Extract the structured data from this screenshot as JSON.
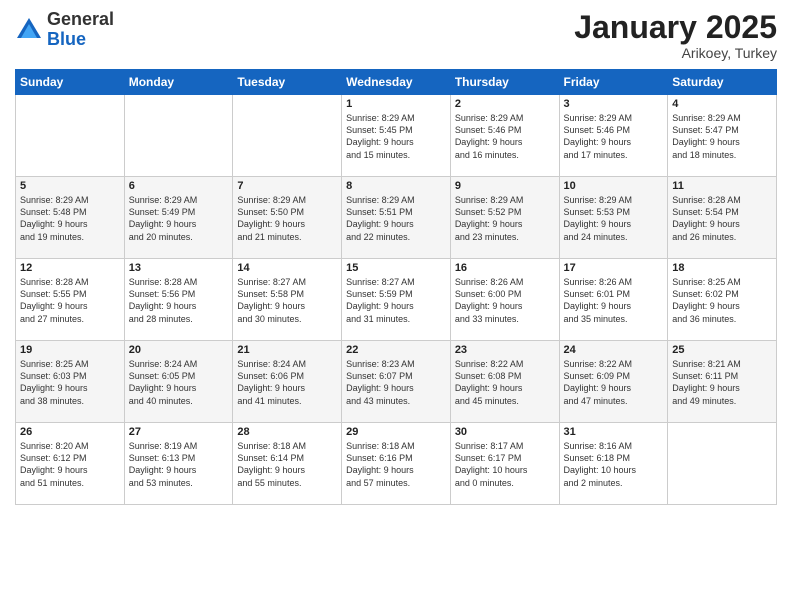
{
  "header": {
    "logo_line1": "General",
    "logo_line2": "Blue",
    "month": "January 2025",
    "location": "Arikoey, Turkey"
  },
  "weekdays": [
    "Sunday",
    "Monday",
    "Tuesday",
    "Wednesday",
    "Thursday",
    "Friday",
    "Saturday"
  ],
  "weeks": [
    [
      {
        "day": "",
        "info": ""
      },
      {
        "day": "",
        "info": ""
      },
      {
        "day": "",
        "info": ""
      },
      {
        "day": "1",
        "info": "Sunrise: 8:29 AM\nSunset: 5:45 PM\nDaylight: 9 hours\nand 15 minutes."
      },
      {
        "day": "2",
        "info": "Sunrise: 8:29 AM\nSunset: 5:46 PM\nDaylight: 9 hours\nand 16 minutes."
      },
      {
        "day": "3",
        "info": "Sunrise: 8:29 AM\nSunset: 5:46 PM\nDaylight: 9 hours\nand 17 minutes."
      },
      {
        "day": "4",
        "info": "Sunrise: 8:29 AM\nSunset: 5:47 PM\nDaylight: 9 hours\nand 18 minutes."
      }
    ],
    [
      {
        "day": "5",
        "info": "Sunrise: 8:29 AM\nSunset: 5:48 PM\nDaylight: 9 hours\nand 19 minutes."
      },
      {
        "day": "6",
        "info": "Sunrise: 8:29 AM\nSunset: 5:49 PM\nDaylight: 9 hours\nand 20 minutes."
      },
      {
        "day": "7",
        "info": "Sunrise: 8:29 AM\nSunset: 5:50 PM\nDaylight: 9 hours\nand 21 minutes."
      },
      {
        "day": "8",
        "info": "Sunrise: 8:29 AM\nSunset: 5:51 PM\nDaylight: 9 hours\nand 22 minutes."
      },
      {
        "day": "9",
        "info": "Sunrise: 8:29 AM\nSunset: 5:52 PM\nDaylight: 9 hours\nand 23 minutes."
      },
      {
        "day": "10",
        "info": "Sunrise: 8:29 AM\nSunset: 5:53 PM\nDaylight: 9 hours\nand 24 minutes."
      },
      {
        "day": "11",
        "info": "Sunrise: 8:28 AM\nSunset: 5:54 PM\nDaylight: 9 hours\nand 26 minutes."
      }
    ],
    [
      {
        "day": "12",
        "info": "Sunrise: 8:28 AM\nSunset: 5:55 PM\nDaylight: 9 hours\nand 27 minutes."
      },
      {
        "day": "13",
        "info": "Sunrise: 8:28 AM\nSunset: 5:56 PM\nDaylight: 9 hours\nand 28 minutes."
      },
      {
        "day": "14",
        "info": "Sunrise: 8:27 AM\nSunset: 5:58 PM\nDaylight: 9 hours\nand 30 minutes."
      },
      {
        "day": "15",
        "info": "Sunrise: 8:27 AM\nSunset: 5:59 PM\nDaylight: 9 hours\nand 31 minutes."
      },
      {
        "day": "16",
        "info": "Sunrise: 8:26 AM\nSunset: 6:00 PM\nDaylight: 9 hours\nand 33 minutes."
      },
      {
        "day": "17",
        "info": "Sunrise: 8:26 AM\nSunset: 6:01 PM\nDaylight: 9 hours\nand 35 minutes."
      },
      {
        "day": "18",
        "info": "Sunrise: 8:25 AM\nSunset: 6:02 PM\nDaylight: 9 hours\nand 36 minutes."
      }
    ],
    [
      {
        "day": "19",
        "info": "Sunrise: 8:25 AM\nSunset: 6:03 PM\nDaylight: 9 hours\nand 38 minutes."
      },
      {
        "day": "20",
        "info": "Sunrise: 8:24 AM\nSunset: 6:05 PM\nDaylight: 9 hours\nand 40 minutes."
      },
      {
        "day": "21",
        "info": "Sunrise: 8:24 AM\nSunset: 6:06 PM\nDaylight: 9 hours\nand 41 minutes."
      },
      {
        "day": "22",
        "info": "Sunrise: 8:23 AM\nSunset: 6:07 PM\nDaylight: 9 hours\nand 43 minutes."
      },
      {
        "day": "23",
        "info": "Sunrise: 8:22 AM\nSunset: 6:08 PM\nDaylight: 9 hours\nand 45 minutes."
      },
      {
        "day": "24",
        "info": "Sunrise: 8:22 AM\nSunset: 6:09 PM\nDaylight: 9 hours\nand 47 minutes."
      },
      {
        "day": "25",
        "info": "Sunrise: 8:21 AM\nSunset: 6:11 PM\nDaylight: 9 hours\nand 49 minutes."
      }
    ],
    [
      {
        "day": "26",
        "info": "Sunrise: 8:20 AM\nSunset: 6:12 PM\nDaylight: 9 hours\nand 51 minutes."
      },
      {
        "day": "27",
        "info": "Sunrise: 8:19 AM\nSunset: 6:13 PM\nDaylight: 9 hours\nand 53 minutes."
      },
      {
        "day": "28",
        "info": "Sunrise: 8:18 AM\nSunset: 6:14 PM\nDaylight: 9 hours\nand 55 minutes."
      },
      {
        "day": "29",
        "info": "Sunrise: 8:18 AM\nSunset: 6:16 PM\nDaylight: 9 hours\nand 57 minutes."
      },
      {
        "day": "30",
        "info": "Sunrise: 8:17 AM\nSunset: 6:17 PM\nDaylight: 10 hours\nand 0 minutes."
      },
      {
        "day": "31",
        "info": "Sunrise: 8:16 AM\nSunset: 6:18 PM\nDaylight: 10 hours\nand 2 minutes."
      },
      {
        "day": "",
        "info": ""
      }
    ]
  ]
}
